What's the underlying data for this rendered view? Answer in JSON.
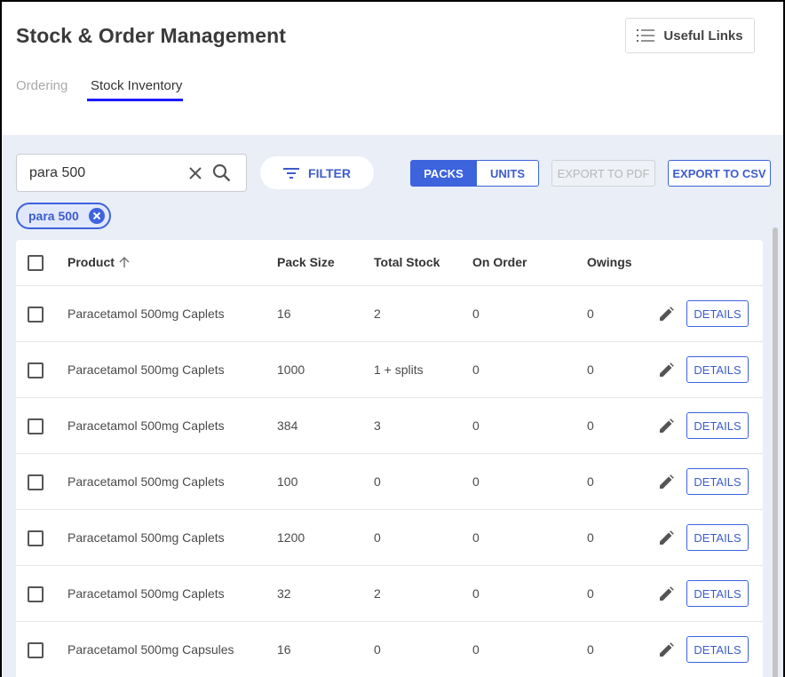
{
  "header": {
    "title": "Stock & Order Management",
    "useful_links_label": "Useful Links",
    "tabs": [
      {
        "label": "Ordering",
        "active": false
      },
      {
        "label": "Stock Inventory",
        "active": true
      }
    ]
  },
  "toolbar": {
    "search_value": "para 500",
    "filter_label": "FILTER",
    "unit_toggle": {
      "packs": "PACKS",
      "units": "UNITS",
      "selected": "PACKS"
    },
    "export_pdf_label": "EXPORT TO PDF",
    "export_csv_label": "EXPORT TO CSV",
    "active_filter_chip": "para 500"
  },
  "table": {
    "columns": {
      "product": "Product",
      "pack_size": "Pack Size",
      "total_stock": "Total Stock",
      "on_order": "On Order",
      "owings": "Owings"
    },
    "details_label": "DETAILS",
    "rows": [
      {
        "product": "Paracetamol 500mg Caplets",
        "pack_size": "16",
        "total_stock": "2",
        "on_order": "0",
        "owings": "0"
      },
      {
        "product": "Paracetamol 500mg Caplets",
        "pack_size": "1000",
        "total_stock": "1 + splits",
        "on_order": "0",
        "owings": "0"
      },
      {
        "product": "Paracetamol 500mg Caplets",
        "pack_size": "384",
        "total_stock": "3",
        "on_order": "0",
        "owings": "0"
      },
      {
        "product": "Paracetamol 500mg Caplets",
        "pack_size": "100",
        "total_stock": "0",
        "on_order": "0",
        "owings": "0"
      },
      {
        "product": "Paracetamol 500mg Caplets",
        "pack_size": "1200",
        "total_stock": "0",
        "on_order": "0",
        "owings": "0"
      },
      {
        "product": "Paracetamol 500mg Caplets",
        "pack_size": "32",
        "total_stock": "2",
        "on_order": "0",
        "owings": "0"
      },
      {
        "product": "Paracetamol 500mg Capsules",
        "pack_size": "16",
        "total_stock": "0",
        "on_order": "0",
        "owings": "0"
      }
    ]
  },
  "colors": {
    "accent": "#3d63dd",
    "tab_underline": "#1a1aff",
    "content_bg": "#e9eef7"
  },
  "icons": {
    "useful_links": "list-icon",
    "search_clear": "close-icon",
    "search": "search-icon",
    "filter": "filter-icon",
    "chip_remove": "close-circle-icon",
    "sort": "arrow-up-icon",
    "edit": "pencil-icon"
  }
}
